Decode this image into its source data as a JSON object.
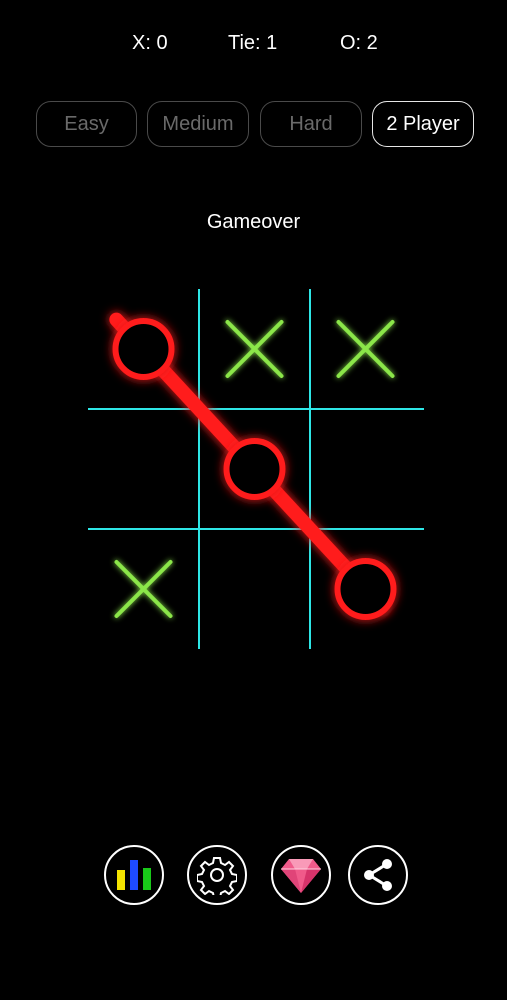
{
  "score": {
    "x": "X: 0",
    "tie": "Tie: 1",
    "o": "O: 2"
  },
  "modes": [
    {
      "label": "Easy",
      "active": false
    },
    {
      "label": "Medium",
      "active": false
    },
    {
      "label": "Hard",
      "active": false
    },
    {
      "label": "2 Player",
      "active": true
    }
  ],
  "status": "Gameover",
  "board": {
    "cells": [
      [
        "O",
        "X",
        "X"
      ],
      [
        "",
        "O",
        ""
      ],
      [
        "X",
        "",
        "O"
      ]
    ],
    "winning_line": [
      [
        0,
        0
      ],
      [
        1,
        1
      ],
      [
        2,
        2
      ]
    ]
  },
  "colors": {
    "background": "#000000",
    "grid": "#2ee6e6",
    "x_mark": "#8be64a",
    "o_mark": "#ff1a1a",
    "win_line": "#ff1a1a",
    "active_mode_border": "#e6e6e6",
    "inactive_mode_border": "#4a4a4a"
  },
  "toolbar": [
    {
      "icon": "stats-bars-icon"
    },
    {
      "icon": "gear-icon"
    },
    {
      "icon": "gem-icon"
    },
    {
      "icon": "share-icon"
    }
  ]
}
